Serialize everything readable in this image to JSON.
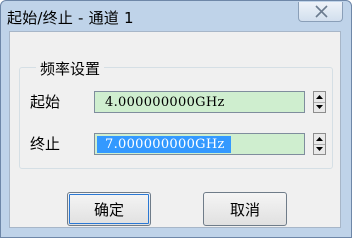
{
  "window": {
    "title": "起始/终止 - 通道 1",
    "close_icon": "close-icon"
  },
  "frequency_group": {
    "label": "频率设置",
    "start": {
      "label": "起始",
      "value": "4.000000000GHz"
    },
    "stop": {
      "label": "终止",
      "value": "7.000000000GHz",
      "selected": true
    }
  },
  "buttons": {
    "ok_label": "确定",
    "cancel_label": "取消"
  },
  "colors": {
    "title_bar": "#bfd3e9",
    "field_background": "#cfeecf",
    "selection_highlight": "#3399ff"
  }
}
